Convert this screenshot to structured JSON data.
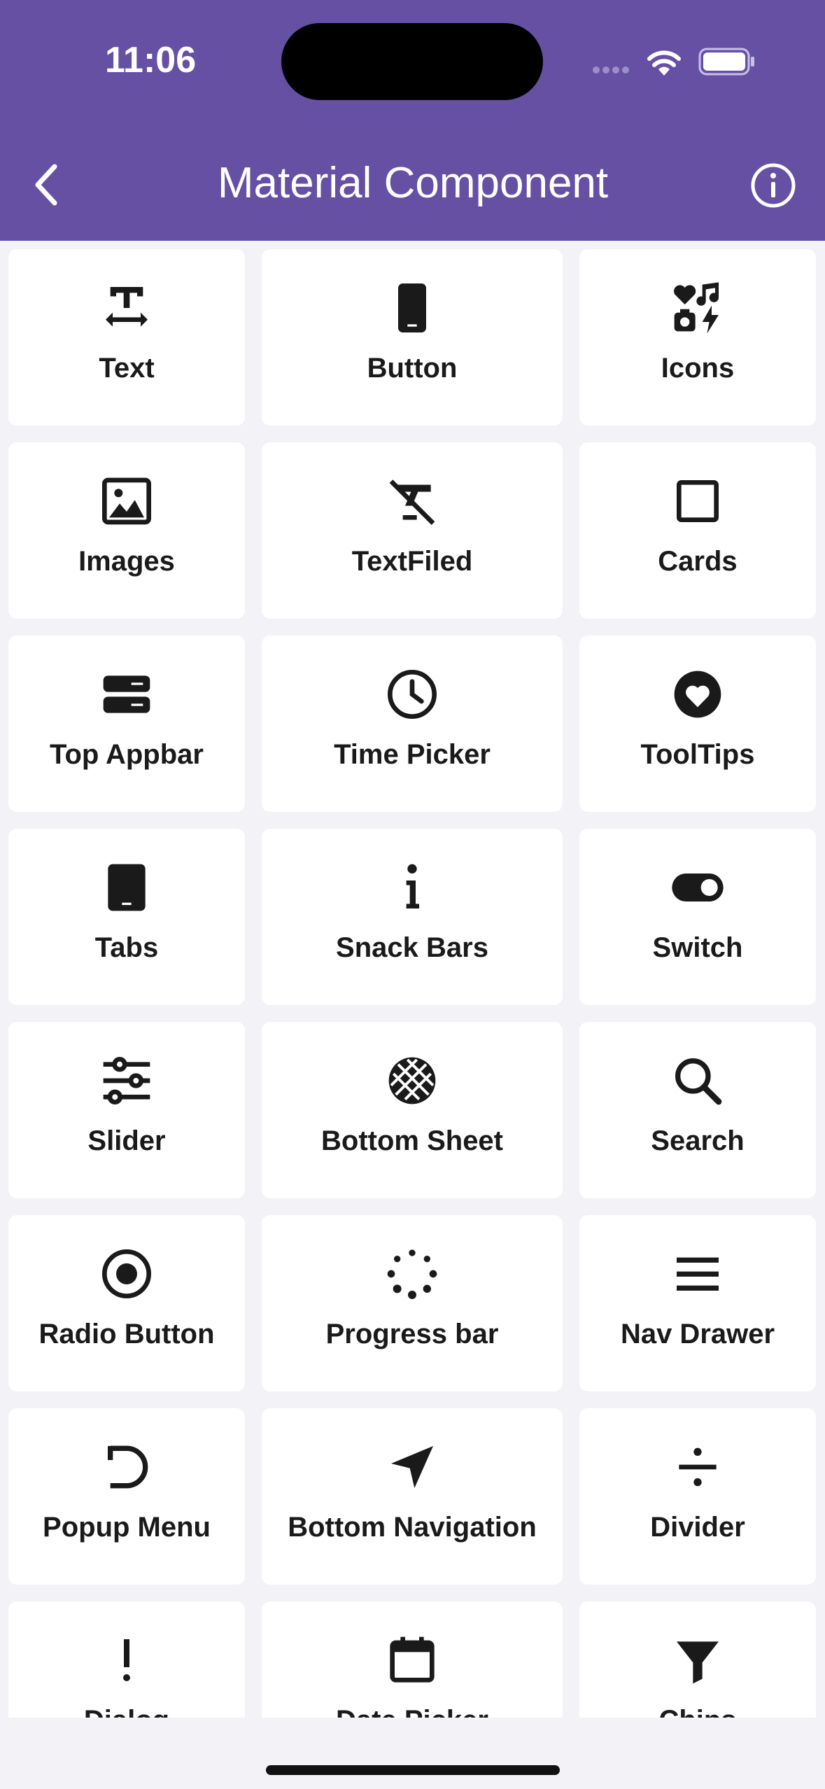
{
  "status_bar": {
    "time": "11:06"
  },
  "app_bar": {
    "title": "Material Component",
    "back_icon": "chevron-left-icon",
    "info_icon": "info-circle-icon"
  },
  "colors": {
    "primary": "#6650a4",
    "tile_bg": "#ffffff",
    "page_bg": "#f2f2f7",
    "text": "#1a1a1a"
  },
  "components": [
    {
      "label": "Text",
      "icon": "text-fields-icon"
    },
    {
      "label": "Button",
      "icon": "smartphone-icon"
    },
    {
      "label": "Icons",
      "icon": "emoji-symbols-icon"
    },
    {
      "label": "Images",
      "icon": "image-icon"
    },
    {
      "label": "TextFiled",
      "icon": "format-clear-icon"
    },
    {
      "label": "Cards",
      "icon": "square-outline-icon"
    },
    {
      "label": "Top Appbar",
      "icon": "view-agenda-icon"
    },
    {
      "label": "Time Picker",
      "icon": "clock-icon"
    },
    {
      "label": "ToolTips",
      "icon": "heart-circle-icon"
    },
    {
      "label": "Tabs",
      "icon": "tablet-icon"
    },
    {
      "label": "Snack Bars",
      "icon": "info-i-icon"
    },
    {
      "label": "Switch",
      "icon": "toggle-on-icon"
    },
    {
      "label": "Slider",
      "icon": "tune-icon"
    },
    {
      "label": "Bottom Sheet",
      "icon": "sports-ball-icon"
    },
    {
      "label": "Search",
      "icon": "search-icon"
    },
    {
      "label": "Radio Button",
      "icon": "radio-button-checked-icon"
    },
    {
      "label": "Progress bar",
      "icon": "loading-dots-icon"
    },
    {
      "label": "Nav Drawer",
      "icon": "menu-icon"
    },
    {
      "label": "Popup Menu",
      "icon": "undo-arc-icon"
    },
    {
      "label": "Bottom Navigation",
      "icon": "navigation-arrow-icon"
    },
    {
      "label": "Divider",
      "icon": "divide-icon"
    },
    {
      "label": "Dialog",
      "icon": "exclamation-icon"
    },
    {
      "label": "Date Picker",
      "icon": "calendar-icon"
    },
    {
      "label": "Chips",
      "icon": "filter-icon"
    }
  ]
}
